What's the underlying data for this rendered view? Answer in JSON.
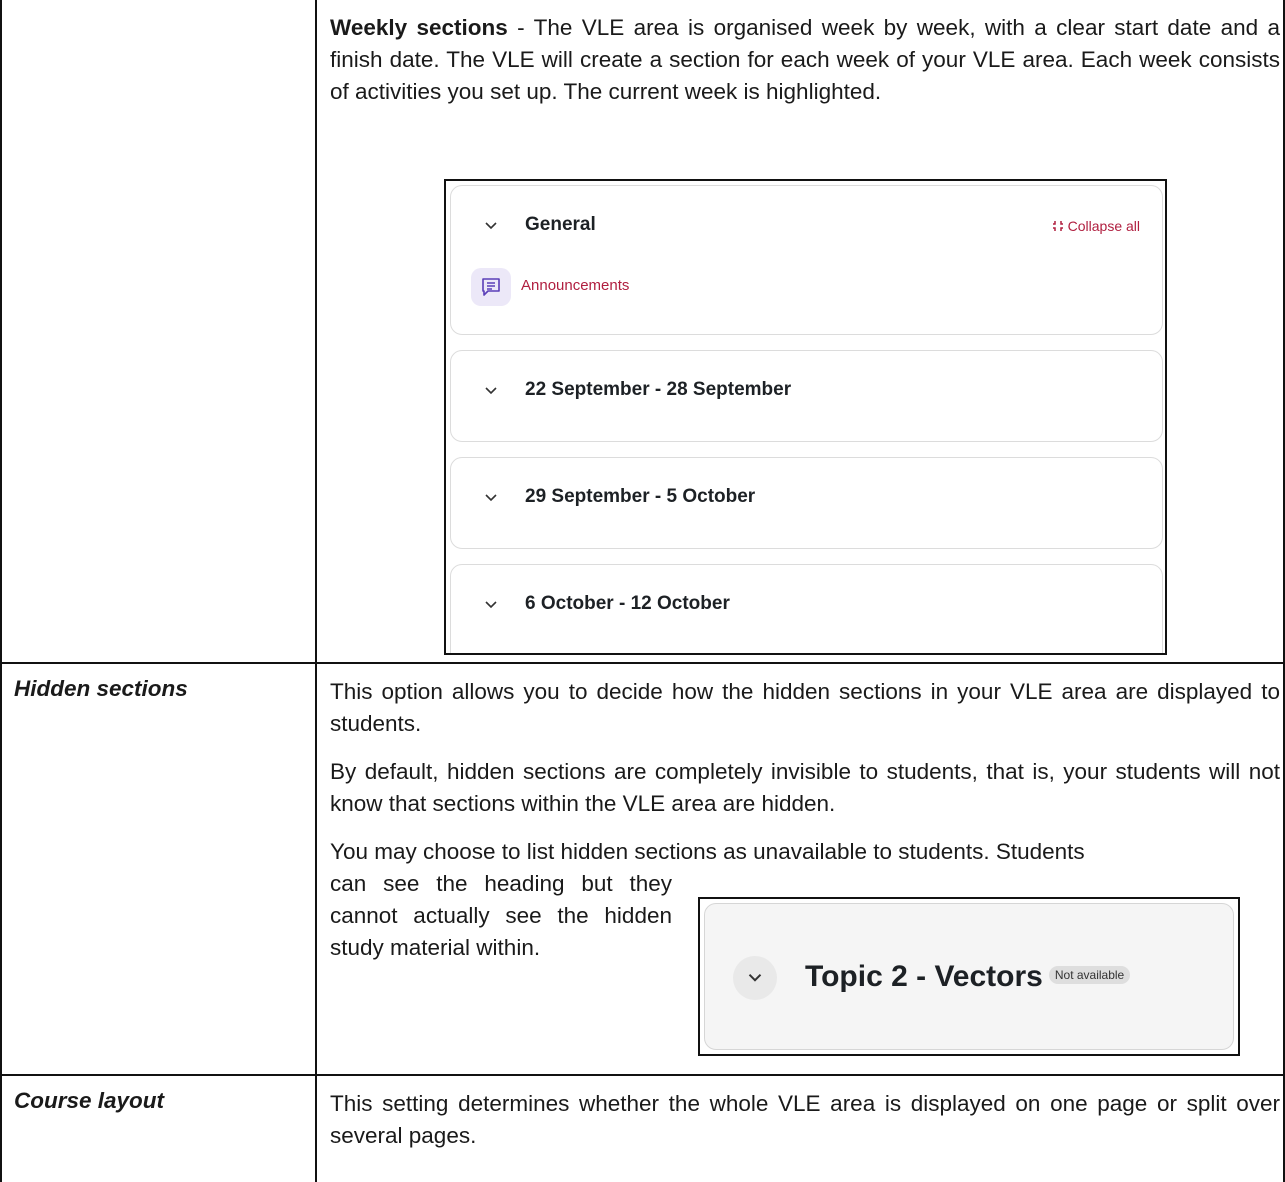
{
  "weekly": {
    "term": "Weekly sections",
    "description": " - The VLE area is organised week by week, with a clear start date and a finish date. The VLE will create a section for each week of your VLE area. Each week consists of activities you set up. The current week is highlighted.",
    "screenshot": {
      "collapse_all": "Collapse all",
      "sections": [
        {
          "title": "General"
        },
        {
          "title": "22 September - 28 September"
        },
        {
          "title": "29 September - 5 October"
        },
        {
          "title": "6 October - 12 October"
        }
      ],
      "activity_label": "Announcements",
      "activity_icon": "forum-icon",
      "accent_color": "#b01e3f"
    }
  },
  "hidden": {
    "label": "Hidden sections",
    "p1": "This option allows you to decide how the hidden sections in your VLE area are displayed to students.",
    "p2": "By default, hidden sections are completely invisible to students, that is, your students will not know that sections within the VLE area are hidden.",
    "p3_line": "You may choose to list hidden sections as unavailable to students. Students",
    "p3_rest": "can see the heading but they cannot actually see the hidden study material within.",
    "screenshot": {
      "title": "Topic 2 - Vectors",
      "badge": "Not available"
    }
  },
  "layout": {
    "label": "Course layout",
    "text": "This setting determines whether the whole VLE area is displayed on one page or split over several pages."
  }
}
